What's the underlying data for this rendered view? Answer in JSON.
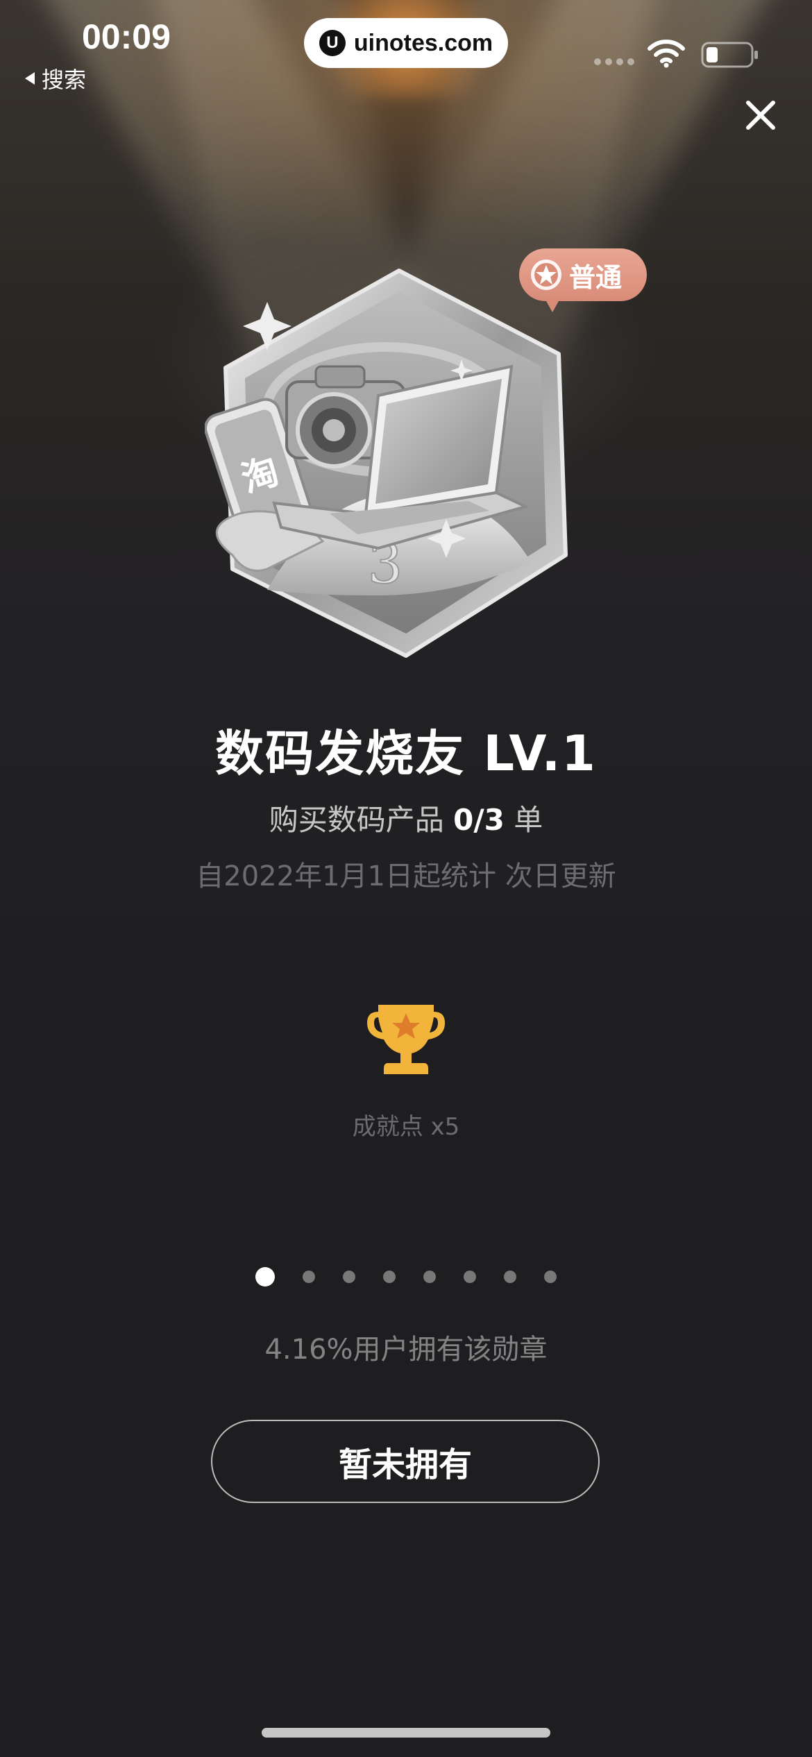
{
  "status_bar": {
    "time": "00:09",
    "back_label": "搜索",
    "url": "uinotes.com",
    "url_logo": "U"
  },
  "icons": {
    "close": "close-icon",
    "trophy": "trophy-icon",
    "wifi": "wifi-icon",
    "battery": "battery-icon",
    "star": "star-icon"
  },
  "badge": {
    "level_tag": "普通",
    "subject": "digital-products",
    "stand_number": "3",
    "phone_glyph": "淘"
  },
  "title": "数码发烧友 LV.1",
  "progress": {
    "prefix": "购买数码产品",
    "count": "0/3",
    "suffix": "单",
    "current": 0,
    "target": 3
  },
  "stats_note": "自2022年1月1日起统计 次日更新",
  "points": "成就点 x5",
  "pager": {
    "total": 8,
    "active_index": 0
  },
  "ownership": "4.16%用户拥有该勋章",
  "button_label": "暂未拥有",
  "colors": {
    "background": "#1e1e20",
    "level_tag": "#d88c78",
    "trophy": "#f2b43a"
  }
}
